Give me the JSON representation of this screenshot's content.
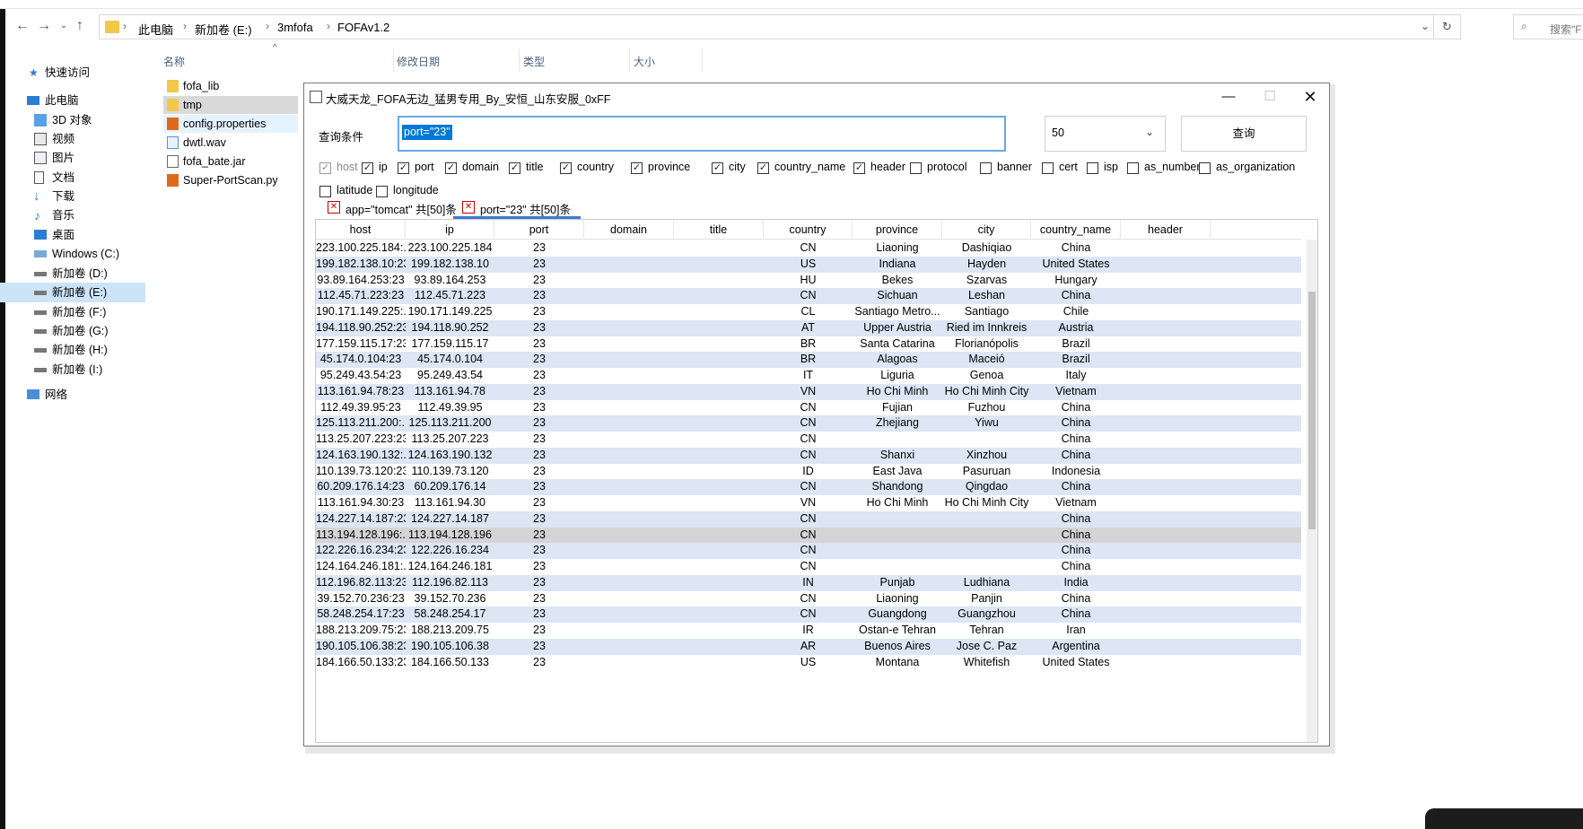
{
  "explorer": {
    "address": [
      "此电脑",
      "新加卷 (E:)",
      "3mfofa",
      "FOFAv1.2"
    ],
    "search_placeholder": "搜索\"F",
    "columns": {
      "name": "名称",
      "date": "修改日期",
      "type": "类型",
      "size": "大小"
    },
    "sidebar": [
      {
        "label": "快速访问",
        "icon": "star-icon"
      },
      {
        "label": "此电脑",
        "icon": "computer-icon"
      },
      {
        "label": "3D 对象",
        "icon": "cube-icon"
      },
      {
        "label": "视频",
        "icon": "video-icon"
      },
      {
        "label": "图片",
        "icon": "picture-icon"
      },
      {
        "label": "文档",
        "icon": "document-icon"
      },
      {
        "label": "下载",
        "icon": "download-icon"
      },
      {
        "label": "音乐",
        "icon": "music-icon"
      },
      {
        "label": "桌面",
        "icon": "desktop-icon"
      },
      {
        "label": "Windows (C:)",
        "icon": "drive-icon"
      },
      {
        "label": "新加卷 (D:)",
        "icon": "drive-icon"
      },
      {
        "label": "新加卷 (E:)",
        "icon": "drive-icon"
      },
      {
        "label": "新加卷 (F:)",
        "icon": "drive-icon"
      },
      {
        "label": "新加卷 (G:)",
        "icon": "drive-icon"
      },
      {
        "label": "新加卷 (H:)",
        "icon": "drive-icon"
      },
      {
        "label": "新加卷 (I:)",
        "icon": "drive-icon"
      },
      {
        "label": "网络",
        "icon": "network-icon"
      }
    ],
    "files": [
      {
        "name": "fofa_lib",
        "icon": "folder-icon"
      },
      {
        "name": "tmp",
        "icon": "folder-icon"
      },
      {
        "name": "config.properties",
        "icon": "sublime-file-icon"
      },
      {
        "name": "dwtl.wav",
        "icon": "audio-file-icon"
      },
      {
        "name": "fofa_bate.jar",
        "icon": "jar-file-icon"
      },
      {
        "name": "Super-PortScan.py",
        "icon": "sublime-file-icon"
      }
    ]
  },
  "app": {
    "title": "大威天龙_FOFA无边_猛男专用_By_安恒_山东安服_0xFF",
    "query_label": "查询条件",
    "query_value": "port=\"23\"",
    "size_value": "50",
    "query_button": "查询",
    "checkboxes": [
      {
        "label": "host",
        "checked": true,
        "disabled": true
      },
      {
        "label": "ip",
        "checked": true
      },
      {
        "label": "port",
        "checked": true
      },
      {
        "label": "domain",
        "checked": true
      },
      {
        "label": "title",
        "checked": true
      },
      {
        "label": "country",
        "checked": true
      },
      {
        "label": "province",
        "checked": true
      },
      {
        "label": "city",
        "checked": true
      },
      {
        "label": "country_name",
        "checked": true
      },
      {
        "label": "header",
        "checked": true
      },
      {
        "label": "protocol",
        "checked": false
      },
      {
        "label": "banner",
        "checked": false
      },
      {
        "label": "cert",
        "checked": false
      },
      {
        "label": "isp",
        "checked": false
      },
      {
        "label": "as_number",
        "checked": false
      },
      {
        "label": "as_organization",
        "checked": false
      },
      {
        "label": "latitude",
        "checked": false
      },
      {
        "label": "longitude",
        "checked": false
      }
    ],
    "tabs": [
      {
        "label": "app=\"tomcat\" 共[50]条",
        "active": false
      },
      {
        "label": "port=\"23\" 共[50]条",
        "active": true
      }
    ],
    "table": {
      "headers": [
        "host",
        "ip",
        "port",
        "domain",
        "title",
        "country",
        "province",
        "city",
        "country_name",
        "header"
      ],
      "selected_row": 18,
      "rows": [
        [
          "223.100.225.184:...",
          "223.100.225.184",
          "23",
          "",
          "",
          "CN",
          "Liaoning",
          "Dashiqiao",
          "China",
          ""
        ],
        [
          "199.182.138.10:23",
          "199.182.138.10",
          "23",
          "",
          "",
          "US",
          "Indiana",
          "Hayden",
          "United States",
          ""
        ],
        [
          "93.89.164.253:23",
          "93.89.164.253",
          "23",
          "",
          "",
          "HU",
          "Bekes",
          "Szarvas",
          "Hungary",
          ""
        ],
        [
          "112.45.71.223:23",
          "112.45.71.223",
          "23",
          "",
          "",
          "CN",
          "Sichuan",
          "Leshan",
          "China",
          ""
        ],
        [
          "190.171.149.225:...",
          "190.171.149.225",
          "23",
          "",
          "",
          "CL",
          "Santiago Metro...",
          "Santiago",
          "Chile",
          ""
        ],
        [
          "194.118.90.252:23",
          "194.118.90.252",
          "23",
          "",
          "",
          "AT",
          "Upper Austria",
          "Ried im Innkreis",
          "Austria",
          ""
        ],
        [
          "177.159.115.17:23",
          "177.159.115.17",
          "23",
          "",
          "",
          "BR",
          "Santa Catarina",
          "Florianópolis",
          "Brazil",
          ""
        ],
        [
          "45.174.0.104:23",
          "45.174.0.104",
          "23",
          "",
          "",
          "BR",
          "Alagoas",
          "Maceió",
          "Brazil",
          ""
        ],
        [
          "95.249.43.54:23",
          "95.249.43.54",
          "23",
          "",
          "",
          "IT",
          "Liguria",
          "Genoa",
          "Italy",
          ""
        ],
        [
          "113.161.94.78:23",
          "113.161.94.78",
          "23",
          "",
          "",
          "VN",
          "Ho Chi Minh",
          "Ho Chi Minh City",
          "Vietnam",
          ""
        ],
        [
          "112.49.39.95:23",
          "112.49.39.95",
          "23",
          "",
          "",
          "CN",
          "Fujian",
          "Fuzhou",
          "China",
          ""
        ],
        [
          "125.113.211.200:...",
          "125.113.211.200",
          "23",
          "",
          "",
          "CN",
          "Zhejiang",
          "Yiwu",
          "China",
          ""
        ],
        [
          "113.25.207.223:23",
          "113.25.207.223",
          "23",
          "",
          "",
          "CN",
          "",
          "",
          "China",
          ""
        ],
        [
          "124.163.190.132:...",
          "124.163.190.132",
          "23",
          "",
          "",
          "CN",
          "Shanxi",
          "Xinzhou",
          "China",
          ""
        ],
        [
          "110.139.73.120:23",
          "110.139.73.120",
          "23",
          "",
          "",
          "ID",
          "East Java",
          "Pasuruan",
          "Indonesia",
          ""
        ],
        [
          "60.209.176.14:23",
          "60.209.176.14",
          "23",
          "",
          "",
          "CN",
          "Shandong",
          "Qingdao",
          "China",
          ""
        ],
        [
          "113.161.94.30:23",
          "113.161.94.30",
          "23",
          "",
          "",
          "VN",
          "Ho Chi Minh",
          "Ho Chi Minh City",
          "Vietnam",
          ""
        ],
        [
          "124.227.14.187:23",
          "124.227.14.187",
          "23",
          "",
          "",
          "CN",
          "",
          "",
          "China",
          ""
        ],
        [
          "113.194.128.196:...",
          "113.194.128.196",
          "23",
          "",
          "",
          "CN",
          "",
          "",
          "China",
          ""
        ],
        [
          "122.226.16.234:23",
          "122.226.16.234",
          "23",
          "",
          "",
          "CN",
          "",
          "",
          "China",
          ""
        ],
        [
          "124.164.246.181:...",
          "124.164.246.181",
          "23",
          "",
          "",
          "CN",
          "",
          "",
          "China",
          ""
        ],
        [
          "112.196.82.113:23",
          "112.196.82.113",
          "23",
          "",
          "",
          "IN",
          "Punjab",
          "Ludhiana",
          "India",
          ""
        ],
        [
          "39.152.70.236:23",
          "39.152.70.236",
          "23",
          "",
          "",
          "CN",
          "Liaoning",
          "Panjin",
          "China",
          ""
        ],
        [
          "58.248.254.17:23",
          "58.248.254.17",
          "23",
          "",
          "",
          "CN",
          "Guangdong",
          "Guangzhou",
          "China",
          ""
        ],
        [
          "188.213.209.75:23",
          "188.213.209.75",
          "23",
          "",
          "",
          "IR",
          "Ostan-e Tehran",
          "Tehran",
          "Iran",
          ""
        ],
        [
          "190.105.106.38:23",
          "190.105.106.38",
          "23",
          "",
          "",
          "AR",
          "Buenos Aires",
          "Jose C. Paz",
          "Argentina",
          ""
        ],
        [
          "184.166.50.133:23",
          "184.166.50.133",
          "23",
          "",
          "",
          "US",
          "Montana",
          "Whitefish",
          "United States",
          ""
        ]
      ]
    }
  },
  "colors": {
    "accent": "#0078d7",
    "row_alt": "#dce6f4",
    "row_selected": "#d4d4d4",
    "tab_underline": "#3d7ad0"
  }
}
